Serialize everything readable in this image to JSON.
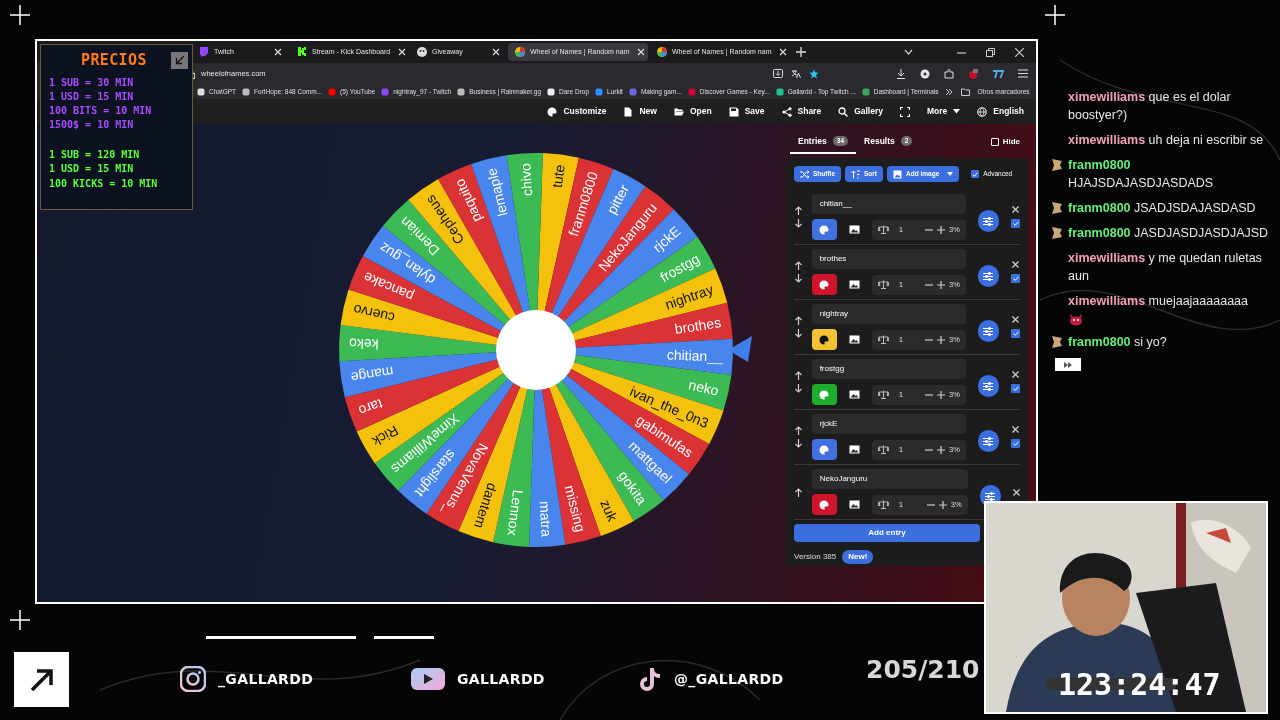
{
  "overlay": {
    "title": "PRECIOS",
    "purple_lines": [
      "1 SUB = 30 MIN",
      "1 USD = 15 MIN",
      "100 BITS = 10 MIN",
      "1500$ = 10 MIN"
    ],
    "green_lines": [
      "1 SUB = 120 MIN",
      "1 USD = 15 MIN",
      "100 KICKS = 10 MIN"
    ]
  },
  "browser": {
    "tabs": [
      {
        "label": "Twitch",
        "kind": "twitch",
        "selected": false
      },
      {
        "label": "Stream - Kick Dashboard",
        "kind": "kick",
        "selected": false
      },
      {
        "label": "Giveaway",
        "kind": "giveaway",
        "selected": false
      },
      {
        "label": "Wheel of Names | Random nam",
        "kind": "wheel",
        "selected": true
      },
      {
        "label": "Wheel of Names | Random nam",
        "kind": "wheel",
        "selected": false
      }
    ],
    "address": "wheelofnames.com",
    "bookmarks": [
      "ChatGPT",
      "FortHope: 848 Comm...",
      "(5) YouTube",
      "nightray_97 - Twitch",
      "Business | Rainmaker.gg",
      "Dare Drop",
      "Lurkit",
      "Making gam...",
      "Discover Games - Key...",
      "Gallardd - Top Twitch ...",
      "Dashboard | Terminals"
    ],
    "other_bookmarks": "Otros marcadores"
  },
  "app": {
    "menu": [
      {
        "kind": "customize",
        "label": "Customize"
      },
      {
        "kind": "new",
        "label": "New"
      },
      {
        "kind": "open",
        "label": "Open"
      },
      {
        "kind": "save",
        "label": "Save"
      },
      {
        "kind": "share",
        "label": "Share"
      },
      {
        "kind": "gallery",
        "label": "Gallery"
      },
      {
        "kind": "fullscreen"
      },
      {
        "kind": "more",
        "label": "More"
      },
      {
        "kind": "language",
        "label": "English"
      }
    ]
  },
  "wheel": {
    "segments": [
      {
        "label": "tute",
        "color": "#f4c20d"
      },
      {
        "label": "franm0800",
        "color": "#db3236"
      },
      {
        "label": "pitter",
        "color": "#4885ed"
      },
      {
        "label": "NekoJanguru",
        "color": "#db3236"
      },
      {
        "label": "rjckE",
        "color": "#4885ed"
      },
      {
        "label": "frostgg",
        "color": "#3cba54"
      },
      {
        "label": "nightray",
        "color": "#f4c20d"
      },
      {
        "label": "brothes",
        "color": "#db3236"
      },
      {
        "label": "chitian__",
        "color": "#4885ed"
      },
      {
        "label": "neko",
        "color": "#3cba54"
      },
      {
        "label": "ivan_the_0n3",
        "color": "#f4c20d"
      },
      {
        "label": "gabimufas",
        "color": "#db3236"
      },
      {
        "label": "mattgael",
        "color": "#4885ed"
      },
      {
        "label": "gokita",
        "color": "#3cba54"
      },
      {
        "label": "zuk",
        "color": "#f4c20d"
      },
      {
        "label": "missing",
        "color": "#db3236"
      },
      {
        "label": "matra",
        "color": "#4885ed"
      },
      {
        "label": "Lennox",
        "color": "#3cba54"
      },
      {
        "label": "dantem",
        "color": "#f4c20d"
      },
      {
        "label": "NovaVenus_",
        "color": "#db3236"
      },
      {
        "label": "starslight",
        "color": "#4885ed"
      },
      {
        "label": "XimeWilliams",
        "color": "#3cba54"
      },
      {
        "label": "Rick",
        "color": "#f4c20d"
      },
      {
        "label": "taro",
        "color": "#db3236"
      },
      {
        "label": "mange",
        "color": "#4885ed"
      },
      {
        "label": "keko",
        "color": "#3cba54"
      },
      {
        "label": "cuervo",
        "color": "#f4c20d"
      },
      {
        "label": "pancake",
        "color": "#db3236"
      },
      {
        "label": "dylan_guz",
        "color": "#4885ed"
      },
      {
        "label": "Demian",
        "color": "#3cba54"
      },
      {
        "label": "Cepheus",
        "color": "#f4c20d"
      },
      {
        "label": "paquito",
        "color": "#db3236"
      },
      {
        "label": "lemaple",
        "color": "#4885ed"
      },
      {
        "label": "chivo",
        "color": "#3cba54"
      }
    ]
  },
  "entries_panel": {
    "tabs": [
      {
        "label": "Entries",
        "count": "34",
        "selected": true
      },
      {
        "label": "Results",
        "count": "2",
        "selected": false
      }
    ],
    "hide": {
      "label": "Hide",
      "checked": false
    },
    "actions": [
      {
        "kind": "shuffle",
        "label": "Shuffle"
      },
      {
        "kind": "sort",
        "label": "Sort"
      },
      {
        "kind": "add_image",
        "label": "Add image"
      }
    ],
    "advanced": {
      "label": "Advanced",
      "checked": true
    },
    "entries": [
      {
        "name": "chitian__",
        "color": "#4170e0",
        "weight": "1",
        "percent": "3%",
        "checked": true
      },
      {
        "name": "brothes",
        "color": "#d0142c",
        "weight": "1",
        "percent": "3%",
        "checked": true
      },
      {
        "name": "nightray",
        "color": "#f1c231",
        "weight": "1",
        "percent": "3%",
        "checked": true
      },
      {
        "name": "frostgg",
        "color": "#1faf2f",
        "weight": "1",
        "percent": "3%",
        "checked": true
      },
      {
        "name": "rjckE",
        "color": "#4170e0",
        "weight": "1",
        "percent": "3%",
        "checked": true
      },
      {
        "name": "NekoJanguru",
        "color": "#d0142c",
        "weight": "1",
        "percent": "3%"
      }
    ],
    "add_entry": "Add entry",
    "version": "Version 385",
    "badge": "New!"
  },
  "chat": [
    {
      "user": "ximewilliams",
      "color": "#f0a0b4",
      "text": "que es el dolar boostyer?)",
      "badge": false,
      "emote": false
    },
    {
      "user": "ximewilliams",
      "color": "#f0a0b4",
      "text": "uh deja ni escribir se",
      "badge": false,
      "emote": false
    },
    {
      "user": "franm0800",
      "color": "#63f07a",
      "text": "HJAJSDAJASDJASDADS",
      "badge": true,
      "emote": false
    },
    {
      "user": "franm0800",
      "color": "#63f07a",
      "text": "JSADJSDAJASDASD",
      "badge": true,
      "emote": false
    },
    {
      "user": "franm0800",
      "color": "#63f07a",
      "text": "JASDJASDJASDJAJSD",
      "badge": true,
      "emote": false
    },
    {
      "user": "ximewilliams",
      "color": "#f0a0b4",
      "text": "y me quedan ruletas aun",
      "badge": false,
      "emote": false
    },
    {
      "user": "ximewilliams",
      "color": "#f0a0b4",
      "text": "muejaajaaaaaaaa",
      "badge": false,
      "emote": true
    },
    {
      "user": "franm0800",
      "color": "#63f07a",
      "text": "si yo?",
      "badge": true,
      "emote": false
    }
  ],
  "footer": {
    "socials": [
      {
        "kind": "instagram",
        "handle": "_GALLARDD"
      },
      {
        "kind": "youtube",
        "handle": "GALLARDD"
      },
      {
        "kind": "tiktok",
        "handle": "@_GALLARDD"
      }
    ],
    "progress": "205/210"
  },
  "webcam": {
    "timer": "123:24:47"
  }
}
